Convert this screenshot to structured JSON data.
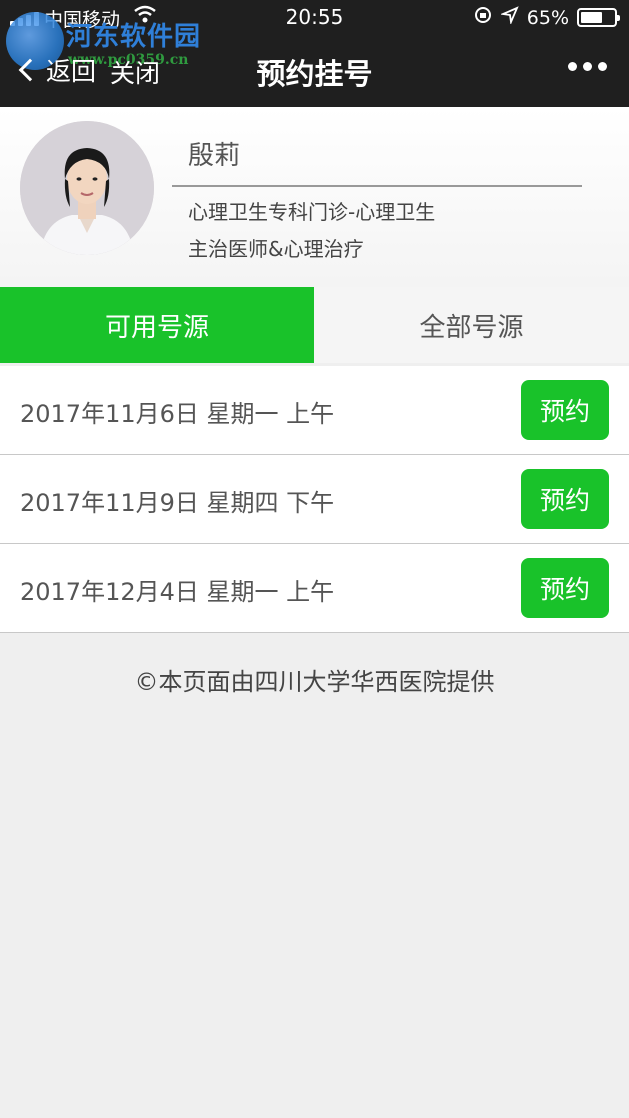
{
  "status_bar": {
    "carrier": "中国移动",
    "time": "20:55",
    "battery_percent": "65%",
    "battery_level": 0.65,
    "icons": [
      "signal-icon",
      "wifi-icon",
      "orientation-lock-icon",
      "location-icon",
      "battery-icon"
    ]
  },
  "watermark": {
    "text": "河东软件园",
    "url": "www.pc0359.cn"
  },
  "nav": {
    "back_label": "返回",
    "close_label": "关闭",
    "title": "预约挂号"
  },
  "doctor": {
    "name": "殷莉",
    "department": "心理卫生专科门诊-心理卫生",
    "title": "主治医师&心理治疗"
  },
  "tabs": [
    {
      "label": "可用号源",
      "active": true
    },
    {
      "label": "全部号源",
      "active": false
    }
  ],
  "slots": [
    {
      "date": "2017年11月6日 星期一 上午",
      "button": "预约"
    },
    {
      "date": "2017年11月9日 星期四 下午",
      "button": "预约"
    },
    {
      "date": "2017年12月4日 星期一 上午",
      "button": "预约"
    }
  ],
  "footer": "©本页面由四川大学华西医院提供",
  "colors": {
    "accent": "#19c22a",
    "topbar": "#1f1f1f"
  }
}
